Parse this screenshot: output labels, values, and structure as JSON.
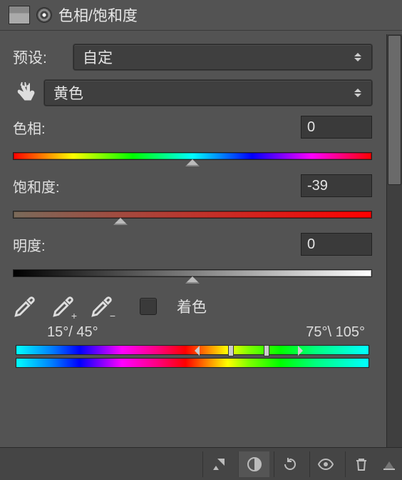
{
  "panel": {
    "title": "色相/饱和度",
    "preset_label": "预设:",
    "preset_value": "自定",
    "channel_value": "黄色",
    "colorize_label": "着色",
    "colorize_checked": false
  },
  "sliders": {
    "hue": {
      "label": "色相:",
      "value": "0",
      "position_pct": 50
    },
    "saturation": {
      "label": "饱和度:",
      "value": "-39",
      "position_pct": 30
    },
    "lightness": {
      "label": "明度:",
      "value": "0",
      "position_pct": 50
    }
  },
  "range": {
    "left_label": "15°/ 45°",
    "right_label": "75°\\ 105°",
    "fade_left_pct": 52,
    "inner_left_pct": 61,
    "inner_right_pct": 71,
    "fade_right_pct": 80
  },
  "eyedroppers": {
    "base": "eyedropper",
    "add": "eyedropper-add",
    "sub": "eyedropper-subtract"
  },
  "icons": {
    "preset": "preset-icon",
    "target": "target-icon",
    "scrub": "scrub-hand-icon"
  },
  "bottom_bar": {
    "clip": "clip-mask-icon",
    "fx": "adjustment-icon",
    "reset": "reset-icon",
    "visible": "visibility-icon",
    "trash": "trash-icon",
    "more": "more-icon"
  }
}
